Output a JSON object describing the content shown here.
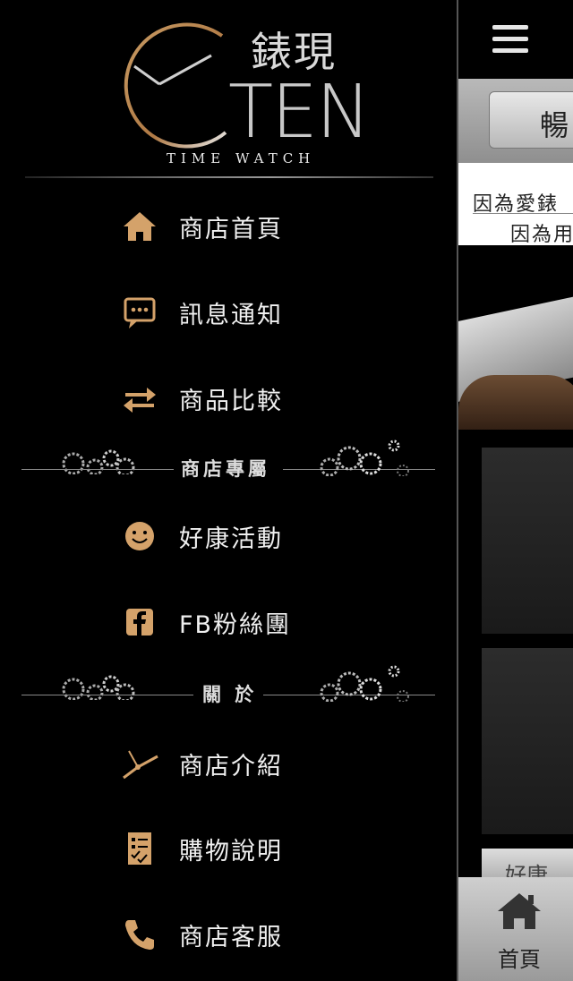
{
  "logo": {
    "chinese": "錶現",
    "english": "TEN",
    "tagline": "TIME  WATCH"
  },
  "menu": {
    "items": [
      {
        "label": "商店首頁",
        "icon": "home-icon"
      },
      {
        "label": "訊息通知",
        "icon": "chat-icon"
      },
      {
        "label": "商品比較",
        "icon": "swap-arrows-icon"
      }
    ],
    "section_store": "商店專屬",
    "store_items": [
      {
        "label": "好康活動",
        "icon": "smiley-icon"
      },
      {
        "label": "FB粉絲團",
        "icon": "facebook-icon"
      }
    ],
    "section_about": "關 於",
    "about_items": [
      {
        "label": "商店介紹",
        "icon": "clock-hands-icon"
      },
      {
        "label": "購物說明",
        "icon": "checklist-icon"
      },
      {
        "label": "商店客服",
        "icon": "phone-icon"
      }
    ]
  },
  "colors": {
    "accent": "#d4a26a",
    "background": "#000000",
    "text": "#f0f0f0"
  },
  "peek": {
    "button_label": "暢",
    "text_line1": "因為愛錶",
    "text_line2": "因為用",
    "card_label": "好康",
    "nav_home": "首頁"
  }
}
